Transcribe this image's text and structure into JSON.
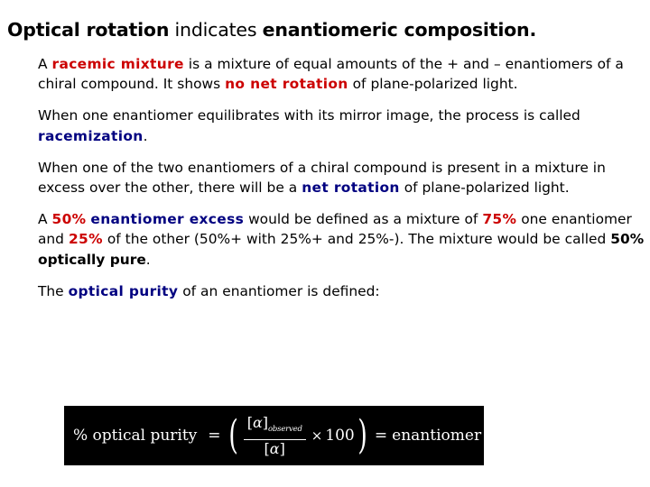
{
  "slide": {
    "background_color": "#ffffff",
    "title": {
      "segment_1_bold": "Optical rotation",
      "segment_2_regular": " indicates ",
      "segment_3_bold": "enantiomeric composition."
    },
    "colors": {
      "text": "#000000",
      "accent_red": "#cc0000",
      "accent_navy": "#000080",
      "formula_background": "#000000",
      "formula_text": "#ffffff"
    },
    "paragraphs": [
      {
        "id": "racemic-mixture",
        "runs": [
          {
            "text": "A ",
            "style": "plain"
          },
          {
            "text": "racemic mixture",
            "style": "red-bold"
          },
          {
            "text": " is a mixture of equal amounts of the + and – enantiomers of a chiral compound. It shows ",
            "style": "plain"
          },
          {
            "text": "no net rotation",
            "style": "red-bold"
          },
          {
            "text": " of plane-polarized light.",
            "style": "plain"
          }
        ]
      },
      {
        "id": "racemization",
        "runs": [
          {
            "text": "When one enantiomer equilibrates with its mirror image, the process is called ",
            "style": "plain"
          },
          {
            "text": "racemization",
            "style": "navy-bold"
          },
          {
            "text": ".",
            "style": "plain"
          }
        ]
      },
      {
        "id": "net-rotation",
        "runs": [
          {
            "text": "When one of the two enantiomers of a chiral compound is present in a mixture in excess over the other, there will be a ",
            "style": "plain"
          },
          {
            "text": "net rotation",
            "style": "navy-bold"
          },
          {
            "text": " of plane-polarized light.",
            "style": "plain"
          }
        ]
      },
      {
        "id": "enantiomer-excess",
        "runs": [
          {
            "text": "A ",
            "style": "plain"
          },
          {
            "text": "50%",
            "style": "red-bold"
          },
          {
            "text": " ",
            "style": "plain"
          },
          {
            "text": "enantiomer excess",
            "style": "navy-bold"
          },
          {
            "text": " would be defined as a mixture of ",
            "style": "plain"
          },
          {
            "text": "75%",
            "style": "red-bold"
          },
          {
            "text": " one enantiomer and ",
            "style": "plain"
          },
          {
            "text": "25%",
            "style": "red-bold"
          },
          {
            "text": " of the other (50%+ with 25%+ and 25%-). The mixture would be called ",
            "style": "plain"
          },
          {
            "text": "50% optically pure",
            "style": "black-bold"
          },
          {
            "text": ".",
            "style": "plain"
          }
        ]
      },
      {
        "id": "optical-purity",
        "runs": [
          {
            "text": "The ",
            "style": "plain"
          },
          {
            "text": "optical purity",
            "style": "navy-bold"
          },
          {
            "text": " of an enantiomer is defined:",
            "style": "plain"
          }
        ]
      }
    ],
    "formula": {
      "left_label": "% optical purity",
      "equals_1": "=",
      "open_paren": "(",
      "numerator_bracket_open": "[",
      "numerator_alpha": "α",
      "numerator_bracket_close": "]",
      "numerator_subscript": "observed",
      "denominator_bracket_open": "[",
      "denominator_alpha": "α",
      "denominator_bracket_close": "]",
      "multiply": "×",
      "factor": "100",
      "close_paren": ")",
      "equals_2": "=",
      "right_label": "enantiomer excess"
    }
  }
}
